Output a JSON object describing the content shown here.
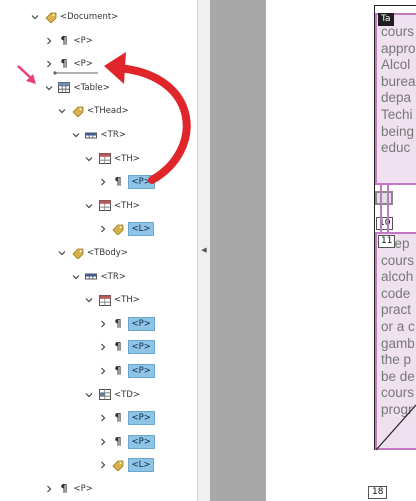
{
  "tags_tree": {
    "rows": [
      {
        "level": 0,
        "chev": "down",
        "icon": "tag",
        "label": "<Document>"
      },
      {
        "level": 1,
        "chev": "right",
        "icon": "para",
        "label": "<P>"
      },
      {
        "level": 1,
        "chev": "right",
        "icon": "para",
        "label": "<P>"
      },
      {
        "level": 1,
        "chev": "down",
        "icon": "table",
        "label": "<Table>"
      },
      {
        "level": 2,
        "chev": "down",
        "icon": "tag",
        "label": "<THead>"
      },
      {
        "level": 3,
        "chev": "down",
        "icon": "tr",
        "label": "<TR>"
      },
      {
        "level": 4,
        "chev": "down",
        "icon": "th",
        "label": "<TH>"
      },
      {
        "level": 5,
        "chev": "right",
        "icon": "para",
        "label": "<P>",
        "selected": true
      },
      {
        "level": 4,
        "chev": "down",
        "icon": "th",
        "label": "<TH>"
      },
      {
        "level": 5,
        "chev": "right",
        "icon": "tag",
        "label": "<L>",
        "selected": true
      },
      {
        "level": 2,
        "chev": "down",
        "icon": "tag",
        "label": "<TBody>"
      },
      {
        "level": 3,
        "chev": "down",
        "icon": "tr",
        "label": "<TR>"
      },
      {
        "level": 4,
        "chev": "down",
        "icon": "th",
        "label": "<TH>"
      },
      {
        "level": 5,
        "chev": "right",
        "icon": "para",
        "label": "<P>",
        "selected": true
      },
      {
        "level": 5,
        "chev": "right",
        "icon": "para",
        "label": "<P>",
        "selected": true
      },
      {
        "level": 5,
        "chev": "right",
        "icon": "para",
        "label": "<P>",
        "selected": true
      },
      {
        "level": 4,
        "chev": "down",
        "icon": "td",
        "label": "<TD>"
      },
      {
        "level": 5,
        "chev": "right",
        "icon": "para",
        "label": "<P>",
        "selected": true
      },
      {
        "level": 5,
        "chev": "right",
        "icon": "para",
        "label": "<P>",
        "selected": true
      },
      {
        "level": 5,
        "chev": "right",
        "icon": "tag",
        "label": "<L>",
        "selected": true
      },
      {
        "level": 1,
        "chev": "right",
        "icon": "para",
        "label": "<P>"
      }
    ]
  },
  "document": {
    "cell1_badge": "Ta",
    "cell1_lines": [
      "cours",
      "appro",
      "Alcol",
      "burea",
      "depa",
      "Techi",
      "being",
      "educ"
    ],
    "badge_10": "10",
    "badge_11": "11",
    "cell2_lines": [
      "ccep",
      "cours",
      "alcoh",
      "code",
      "pract",
      "or a c",
      "gamb",
      "the p",
      "be de",
      "cours",
      "progr"
    ],
    "page_number": "18"
  },
  "colors": {
    "selection": "#8ec4e6",
    "tag_highlight": "#c179c1",
    "arrow": "#e0262a",
    "pointer": "#e8417a"
  }
}
